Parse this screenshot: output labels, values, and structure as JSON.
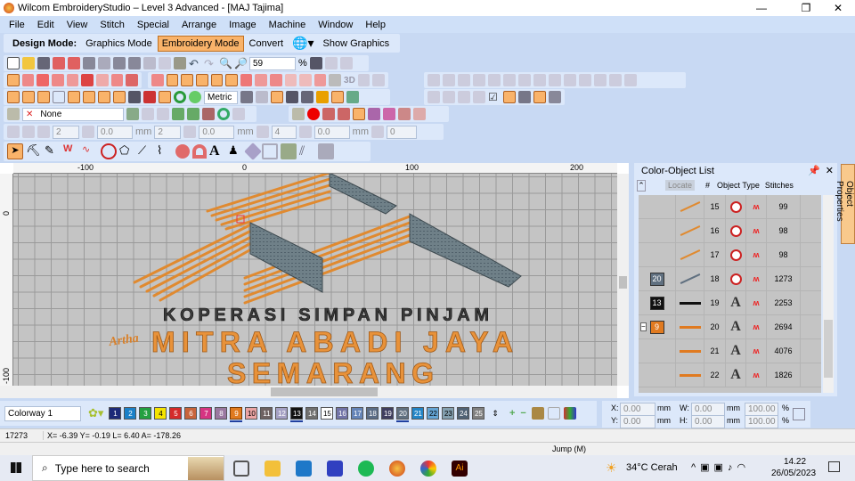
{
  "window": {
    "title": "Wilcom EmbroideryStudio – Level 3 Advanced - [MAJ          Tajima]",
    "minimize": "—",
    "restore": "❐",
    "close": "✕"
  },
  "menu": [
    "File",
    "Edit",
    "View",
    "Stitch",
    "Special",
    "Arrange",
    "Image",
    "Machine",
    "Window",
    "Help"
  ],
  "design_mode": {
    "label": "Design Mode:",
    "graphics": "Graphics Mode",
    "embroidery": "Embroidery Mode",
    "convert": "Convert",
    "show_graphics": "Show Graphics"
  },
  "toolbar": {
    "zoom_value": "59",
    "zoom_unit": "%",
    "units": "Metric",
    "fabric": "None",
    "spin1": "2",
    "spin2": "0.0",
    "mm": "mm",
    "spin3": "2",
    "spin4": "0.0",
    "spin5": "4",
    "spin6": "0.0",
    "spin7": "0",
    "label_3d": "3D"
  },
  "rulers": {
    "top": [
      "-100",
      "0",
      "100",
      "200"
    ],
    "left": [
      "0",
      "-100"
    ]
  },
  "design": {
    "line1": "KOPERASI SIMPAN PINJAM",
    "script": "Artha",
    "line2": "MITRA ABADI JAYA",
    "line3": "SEMARANG"
  },
  "panel": {
    "title": "Color-Object List",
    "locate": "Locate",
    "col_num": "#",
    "col_type": "Object Type",
    "col_stitches": "Stitches",
    "rows": [
      {
        "chip": "",
        "num": "15",
        "type": "complex",
        "stitches": "99",
        "color": "#e08a30"
      },
      {
        "chip": "",
        "num": "16",
        "type": "complex",
        "stitches": "98",
        "color": "#e08a30"
      },
      {
        "chip": "",
        "num": "17",
        "type": "complex",
        "stitches": "98",
        "color": "#e08a30"
      },
      {
        "chip": "20",
        "num": "18",
        "type": "complex",
        "stitches": "1273",
        "color": "#607080"
      },
      {
        "chip": "13",
        "num": "19",
        "type": "A",
        "stitches": "2253",
        "color": "#111111"
      },
      {
        "chip": "9",
        "num": "20",
        "type": "A",
        "stitches": "2694",
        "color": "#e07a20"
      },
      {
        "chip": "",
        "num": "21",
        "type": "A",
        "stitches": "4076",
        "color": "#e07a20"
      },
      {
        "chip": "",
        "num": "22",
        "type": "A",
        "stitches": "1826",
        "color": "#e07a20"
      }
    ]
  },
  "object_properties_tab": "Object Properties",
  "colorway": {
    "name": "Colorway 1",
    "swatches": [
      {
        "n": "1",
        "c": "#1c2a78"
      },
      {
        "n": "2",
        "c": "#1a80c8"
      },
      {
        "n": "3",
        "c": "#23a040"
      },
      {
        "n": "4",
        "c": "#f5e400"
      },
      {
        "n": "5",
        "c": "#d42a2a"
      },
      {
        "n": "6",
        "c": "#c8643c"
      },
      {
        "n": "7",
        "c": "#d63482"
      },
      {
        "n": "8",
        "c": "#9a78a0"
      },
      {
        "n": "9",
        "c": "#e07a20"
      },
      {
        "n": "10",
        "c": "#eaa4a4"
      },
      {
        "n": "11",
        "c": "#6e6262"
      },
      {
        "n": "12",
        "c": "#a4a0c4"
      },
      {
        "n": "13",
        "c": "#111111"
      },
      {
        "n": "14",
        "c": "#707070"
      },
      {
        "n": "15",
        "c": "#ffffff"
      },
      {
        "n": "16",
        "c": "#7274a8"
      },
      {
        "n": "17",
        "c": "#6484b8"
      },
      {
        "n": "18",
        "c": "#5a6c86"
      },
      {
        "n": "19",
        "c": "#3e3e60"
      },
      {
        "n": "20",
        "c": "#607080"
      },
      {
        "n": "21",
        "c": "#2284c6"
      },
      {
        "n": "22",
        "c": "#64a4d4"
      },
      {
        "n": "23",
        "c": "#84a0b0"
      },
      {
        "n": "24",
        "c": "#506274"
      },
      {
        "n": "25",
        "c": "#808080"
      }
    ]
  },
  "transform": {
    "x_label": "X:",
    "x": "0.00",
    "y_label": "Y:",
    "y": "0.00",
    "w_label": "W:",
    "w": "0.00",
    "h_label": "H:",
    "h": "0.00",
    "unit": "mm",
    "sx": "100.00",
    "sy": "100.00",
    "pct": "%"
  },
  "status": {
    "stitches": "17273",
    "coords": "X=  -6.39 Y=  -0.19 L=   6.40 A= -178.26",
    "mode": "Jump (M)"
  },
  "taskbar": {
    "search": "Type here to search",
    "weather": "34°C  Cerah",
    "time": "14.22",
    "date": "26/05/2023"
  }
}
